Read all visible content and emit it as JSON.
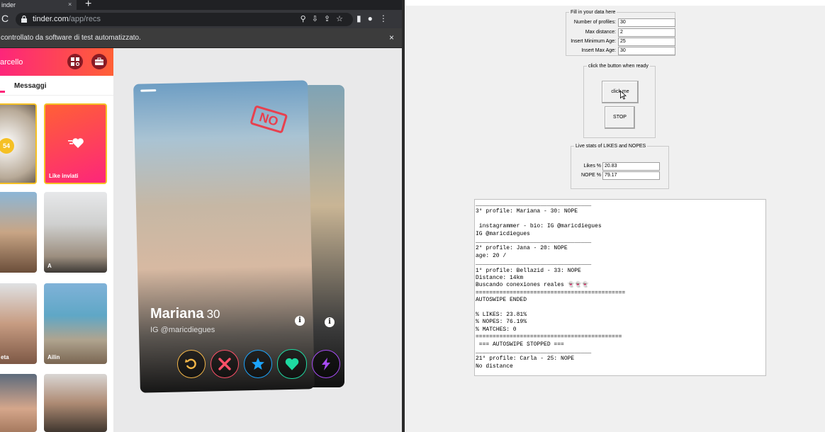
{
  "browser": {
    "tab_title": "inder",
    "tab_close": "×",
    "new_tab": "+",
    "url_host": "tinder.com",
    "url_path": "/app/recs",
    "infobar_text": "controllato da software di test automatizzato.",
    "infobar_close": "×"
  },
  "tinder": {
    "header_name": "arcello",
    "tab_messages": "Messaggi",
    "likes_count": "54",
    "likes_sent_label": "Like inviati",
    "tiles": [
      "A",
      "eta",
      "Ailin"
    ],
    "profile": {
      "name": "Mariana",
      "age": "30",
      "bio": "IG @maricdiegues",
      "stamp": "NO",
      "info": "i"
    },
    "colors": {
      "brand_start": "#fd267a",
      "brand_end": "#ff6036",
      "rewind": "#f5b748",
      "nope": "#fd5068",
      "super": "#1ca4fc",
      "like": "#1ed9a1",
      "boost": "#a64bf4"
    }
  },
  "gui": {
    "form": {
      "legend": "Fill in your data here",
      "fields": [
        {
          "label": "Number of profiles:",
          "value": "30"
        },
        {
          "label": "Max distance:",
          "value": "2"
        },
        {
          "label": "Insert Minimum Age:",
          "value": "25"
        },
        {
          "label": "Insert Max Age:",
          "value": "30"
        }
      ]
    },
    "controls": {
      "legend": "click the button when ready",
      "start_label": "click me",
      "stop_label": "STOP"
    },
    "stats": {
      "legend": "Live stats of LIKES and NOPES",
      "likes_label": "Likes %",
      "likes_value": "20.83",
      "nopes_label": "NOPE %",
      "nopes_value": "79.17"
    },
    "log_lines": [
      "__________________________________",
      "3° profile: Mariana - 30: NOPE",
      "",
      " instagrammer - bio: IG @maricdiegues",
      "IG @maricdiegues",
      "__________________________________",
      "2° profile: Jana - 20: NOPE",
      "age: 20 /",
      "__________________________________",
      "1° profile: Bellazid - 33: NOPE",
      "Distance: 14km",
      "Buscando conexiones reales 👻👻👻",
      "============================================",
      "AUTOSWIPE ENDED",
      "",
      "% LIKES: 23.81%",
      "% NOPES: 76.19%",
      "% MATCHES: 0",
      "===========================================",
      " === AUTOSWIPE STOPPED ===",
      "__________________________________",
      "21° profile: Carla - 25: NOPE",
      "No distance"
    ]
  }
}
